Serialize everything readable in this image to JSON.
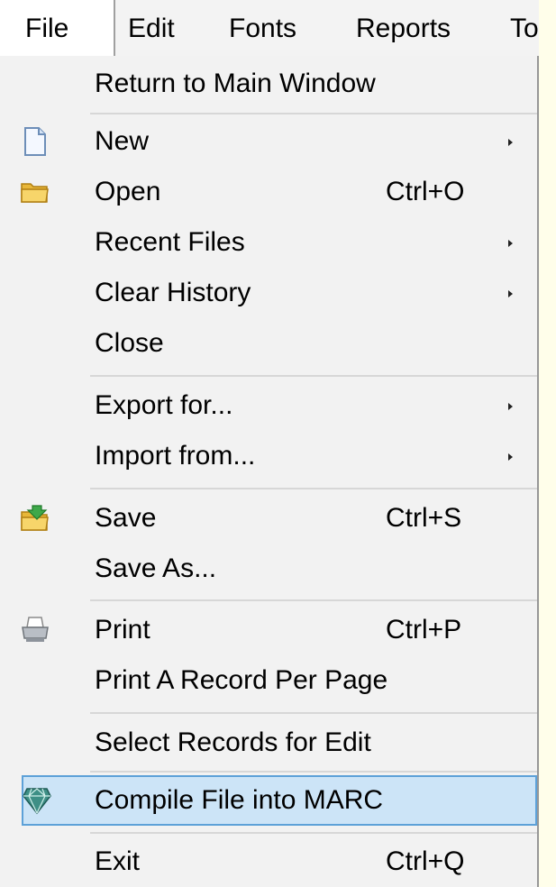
{
  "menubar": {
    "items": [
      "File",
      "Edit",
      "Fonts",
      "Reports",
      "To"
    ]
  },
  "menu": {
    "return_main": "Return to Main Window",
    "new": "New",
    "open": "Open",
    "open_shortcut": "Ctrl+O",
    "recent_files": "Recent Files",
    "clear_history": "Clear History",
    "close": "Close",
    "export_for": "Export for...",
    "import_from": "Import from...",
    "save": "Save",
    "save_shortcut": "Ctrl+S",
    "save_as": "Save As...",
    "print": "Print",
    "print_shortcut": "Ctrl+P",
    "print_record_per_page": "Print A Record Per Page",
    "select_records": "Select Records for Edit",
    "compile_marc": "Compile File into MARC",
    "exit": "Exit",
    "exit_shortcut": "Ctrl+Q"
  },
  "icons": {
    "new": "new-document-icon",
    "open": "folder-icon",
    "save": "save-folder-icon",
    "print": "printer-icon",
    "compile": "diamond-compile-icon"
  },
  "colors": {
    "highlight_bg": "#CCE4F7",
    "highlight_border": "#5DA1D8",
    "menu_bg": "#F2F2F2",
    "page_bg": "#FFFEEA"
  }
}
